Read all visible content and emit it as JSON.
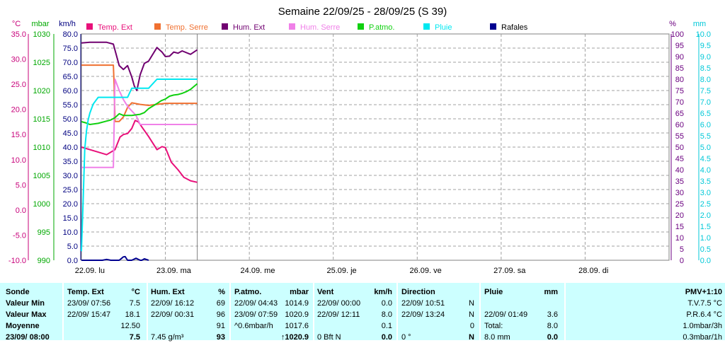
{
  "chart_data": {
    "type": "line",
    "title": "Semaine 22/09/25 - 28/09/25 (S 39)",
    "axes": {
      "left": [
        {
          "unit": "°C",
          "color": "#c8007a",
          "ticks": [
            "35.0",
            "30.0",
            "25.0",
            "20.0",
            "15.0",
            "10.0",
            "5.0",
            "0.0",
            "-5.0",
            "-10.0"
          ],
          "ylim": [
            -10,
            35
          ]
        },
        {
          "unit": "mbar",
          "color": "#00a800",
          "ticks": [
            "1030",
            "1025",
            "1020",
            "1015",
            "1010",
            "1005",
            "1000",
            "995",
            "990"
          ],
          "ylim": [
            990,
            1030
          ]
        },
        {
          "unit": "km/h",
          "color": "#000080",
          "ticks": [
            "80.0",
            "75.0",
            "70.0",
            "65.0",
            "60.0",
            "55.0",
            "50.0",
            "45.0",
            "40.0",
            "35.0",
            "30.0",
            "25.0",
            "20.0",
            "15.0",
            "10.0",
            "5.0",
            "0.0"
          ],
          "ylim": [
            0,
            80
          ]
        }
      ],
      "right": [
        {
          "unit": "%",
          "color": "#6b0080",
          "ticks": [
            "100",
            "95",
            "90",
            "85",
            "80",
            "75",
            "70",
            "65",
            "60",
            "55",
            "50",
            "45",
            "40",
            "35",
            "30",
            "25",
            "20",
            "15",
            "10",
            "5",
            "0"
          ],
          "ylim": [
            0,
            100
          ]
        },
        {
          "unit": "mm",
          "color": "#00c8d8",
          "ticks": [
            "10.0",
            "9.5",
            "9.0",
            "8.5",
            "8.0",
            "7.5",
            "7.0",
            "6.5",
            "6.0",
            "5.5",
            "5.0",
            "4.5",
            "4.0",
            "3.5",
            "3.0",
            "2.5",
            "2.0",
            "1.5",
            "1.0",
            "0.5",
            "0.0"
          ],
          "ylim": [
            0,
            10
          ]
        }
      ]
    },
    "x_labels": [
      "22.09.  lu",
      "23.09.  ma",
      "24.09.  me",
      "25.09.  je",
      "26.09.  ve",
      "27.09.  sa",
      "28.09.  di"
    ],
    "xlim": [
      0,
      7
    ],
    "grid": true,
    "legend_position": "top",
    "series": [
      {
        "name": "Temp. Ext",
        "color": "#e8107a",
        "axis": "°C",
        "x": [
          0,
          0.1,
          0.2,
          0.3,
          0.4,
          0.46,
          0.5,
          0.55,
          0.6,
          0.64,
          0.68,
          0.72,
          0.8,
          0.9,
          0.96,
          1.0,
          1.07,
          1.15,
          1.22,
          1.3,
          1.38
        ],
        "y": [
          12.5,
          12.0,
          11.5,
          11.0,
          12.0,
          14.5,
          15.0,
          15.2,
          16.2,
          17.8,
          17.5,
          16.5,
          14.6,
          12.0,
          12.6,
          12.4,
          9.5,
          8.0,
          6.5,
          5.8,
          5.5
        ]
      },
      {
        "name": "Temp. Serre",
        "color": "#f07030",
        "axis": "°C",
        "x": [
          0,
          0.38,
          0.39,
          0.4,
          0.45,
          0.5,
          0.55,
          0.6,
          0.7,
          0.8,
          1.0,
          1.2,
          1.38
        ],
        "y": [
          28.8,
          28.8,
          25.0,
          17.6,
          17.6,
          18.5,
          20.4,
          21.3,
          21.0,
          20.8,
          21.2,
          21.2,
          21.2
        ]
      },
      {
        "name": "Hum. Ext",
        "color": "#700070",
        "axis": "%",
        "x": [
          0,
          0.1,
          0.2,
          0.3,
          0.38,
          0.45,
          0.5,
          0.55,
          0.6,
          0.63,
          0.66,
          0.7,
          0.75,
          0.8,
          0.9,
          0.96,
          1.0,
          1.05,
          1.1,
          1.15,
          1.2,
          1.3,
          1.38
        ],
        "y": [
          96,
          96.3,
          96.3,
          96.3,
          95.5,
          86,
          84.3,
          86,
          81,
          77,
          75,
          82,
          87,
          88,
          94,
          92,
          90,
          90.2,
          92,
          91.5,
          92.5,
          91,
          93
        ]
      },
      {
        "name": "Hum. Serre",
        "color": "#f080e8",
        "axis": "%",
        "x": [
          0,
          0.38,
          0.39,
          0.4,
          0.45,
          0.5,
          0.55,
          0.6,
          0.65,
          0.7,
          0.8,
          1.0,
          1.2,
          1.38
        ],
        "y": [
          41,
          41,
          60,
          80,
          75,
          71,
          68,
          66,
          64,
          60,
          60,
          60,
          60,
          60
        ]
      },
      {
        "name": "P.atmo.",
        "color": "#10d010",
        "axis": "mbar",
        "x": [
          0,
          0.05,
          0.1,
          0.2,
          0.3,
          0.35,
          0.4,
          0.45,
          0.5,
          0.55,
          0.6,
          0.65,
          0.7,
          0.75,
          0.8,
          0.9,
          0.95,
          1.0,
          1.05,
          1.1,
          1.15,
          1.2,
          1.25,
          1.3,
          1.38
        ],
        "y": [
          1014.5,
          1014.3,
          1014.0,
          1014.2,
          1014.6,
          1014.8,
          1015.2,
          1015.9,
          1015.6,
          1015.6,
          1015.6,
          1015.7,
          1015.8,
          1016.1,
          1016.8,
          1017.7,
          1018.2,
          1018.5,
          1019.0,
          1019.2,
          1019.3,
          1019.5,
          1019.8,
          1020.2,
          1021.2
        ]
      },
      {
        "name": "Pluie",
        "color": "#00e8f0",
        "axis": "mm",
        "x": [
          0,
          0.02,
          0.04,
          0.06,
          0.08,
          0.1,
          0.14,
          0.2,
          0.3,
          0.38,
          0.4,
          0.5,
          0.55,
          0.6,
          0.7,
          0.8,
          0.9,
          1.0,
          1.38
        ],
        "y": [
          0.4,
          2.6,
          4.9,
          5.7,
          6.2,
          6.5,
          6.9,
          7.2,
          7.2,
          7.2,
          7.2,
          7.2,
          7.2,
          7.6,
          7.6,
          7.6,
          8.0,
          8.0,
          8.0
        ]
      },
      {
        "name": "Rafales",
        "color": "#000090",
        "axis": "km/h",
        "x": [
          0,
          0.25,
          0.3,
          0.35,
          0.4,
          0.45,
          0.5,
          0.52,
          0.55,
          0.6,
          0.65,
          0.7,
          0.72,
          0.75,
          0.8
        ],
        "y": [
          0,
          0,
          0.3,
          0,
          0,
          0,
          1.2,
          1.3,
          0,
          0,
          0.7,
          0,
          0,
          0.5,
          0
        ]
      }
    ]
  },
  "stats_table": {
    "header": [
      "Sonde",
      "Temp. Ext",
      "°C",
      "Hum. Ext",
      "%",
      "P.atmo.",
      "mbar",
      "Vent",
      "km/h",
      "Direction",
      "Pluie",
      "mm",
      "PMV+1:10"
    ],
    "rows": {
      "min": {
        "label": "Valeur Min",
        "temp_dt": "23/09/  07:56",
        "temp": "7.5",
        "hum_dt": "22/09/  16:12",
        "hum": "69",
        "p_dt": "22/09/  04:43",
        "p": "1014.9",
        "v_dt": "22/09/  00:00",
        "v": "0.0",
        "d_dt": "22/09/  10:51",
        "d": "N",
        "r_dt": "",
        "r": "",
        "pmv": "T.V.7.5 °C"
      },
      "max": {
        "label": "Valeur Max",
        "temp_dt": "22/09/  15:47",
        "temp": "18.1",
        "hum_dt": "22/09/  00:31",
        "hum": "96",
        "p_dt": "23/09/  07:59",
        "p": "1020.9",
        "v_dt": "22/09/  12:11",
        "v": "8.0",
        "d_dt": "22/09/  13:24",
        "d": "N",
        "r_dt": "22/09/  01:49",
        "r": "3.6",
        "pmv": "P.R.6.4 °C"
      },
      "avg": {
        "label": "Moyenne",
        "temp_dt": "",
        "temp": "12.50",
        "hum_dt": "",
        "hum": "91",
        "p_dt": "^0.6mbar/h",
        "p": "1017.6",
        "v_dt": "",
        "v": "0.1",
        "d_dt": "",
        "d": "0",
        "r_dt": "Total:",
        "r": "8.0",
        "pmv": "1.0mbar/3h"
      },
      "cur": {
        "label": "23/09/ 08:00",
        "temp_dt": "",
        "temp": "7.5",
        "hum_dt": "7.45 g/m³",
        "hum": "93",
        "p_dt": "",
        "p": "↑1020.9",
        "v_dt": "0 Bft N",
        "v": "0.0",
        "d_dt": "0 °",
        "d": "N",
        "r_dt": "8.0 mm",
        "r": "0.0",
        "pmv": "0.3mbar/1h"
      }
    }
  }
}
